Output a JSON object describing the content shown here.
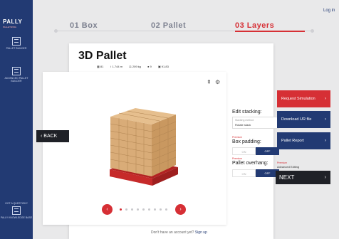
{
  "brand": {
    "logo": "PALLY",
    "tagline": "PALLETIZING"
  },
  "sidebar": {
    "items": [
      {
        "label": "PALLET BUILDER"
      },
      {
        "label": "ADVANCED PALLET BUILDER"
      }
    ],
    "bottom_items": [
      {
        "label": "GOT A QUESTION?"
      },
      {
        "label": "PALLY KNOWLEDGE BASE"
      }
    ]
  },
  "header": {
    "login": "Log in"
  },
  "steps": [
    {
      "label": "01 Box",
      "active": false
    },
    {
      "label": "02 Pallet",
      "active": false
    },
    {
      "label": "03 Layers",
      "active": true
    }
  ],
  "card": {
    "title": "3D Pallet",
    "stats": [
      "81",
      "1.744 m",
      "209 kg",
      "9",
      "91.83"
    ]
  },
  "back_button": "BACK",
  "panel": {
    "stacking_label": "Edit stacking:",
    "stacking_select_label": "Stacking method",
    "stacking_select_value": "Rotate stack",
    "premium_tag": "Premium",
    "box_padding_label": "Box padding:",
    "pallet_overhang_label": "Pallet overhang:",
    "toggle_off": "ON",
    "toggle_on": "OFF"
  },
  "actions": {
    "request_simulation": "Request Simulation",
    "download_urf": "Download UR file",
    "pallet_report": "Pallet Report",
    "advanced_editing": "Advanced Editing",
    "next": "NEXT"
  },
  "footer": {
    "text": "Don't have an account yet?",
    "link": "Sign up"
  },
  "colors": {
    "accent": "#d62f35",
    "navy": "#223a73",
    "box": "#d6a56c",
    "pallet": "#c62a2a"
  }
}
